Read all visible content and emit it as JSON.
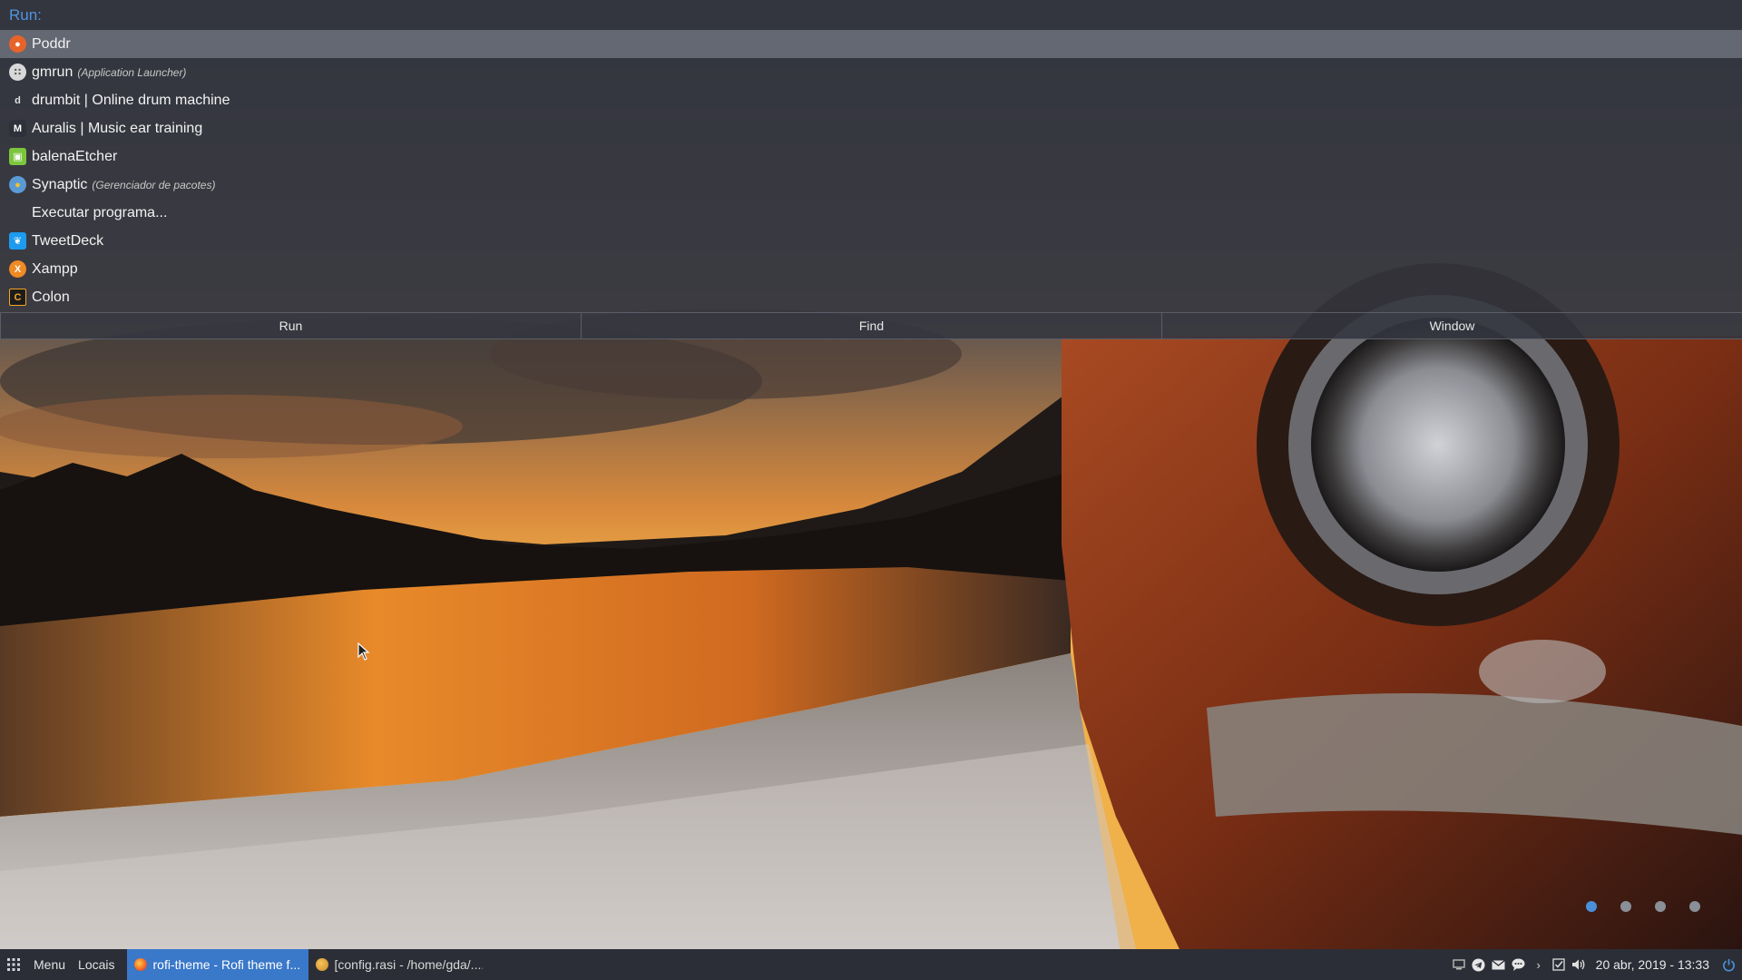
{
  "rofi": {
    "prompt": "Run:",
    "items": [
      {
        "name": "Poddr",
        "subtitle": "",
        "icon": "poddr-icon",
        "selected": true
      },
      {
        "name": "gmrun",
        "subtitle": "(Application Launcher)",
        "icon": "gmrun-icon",
        "selected": false
      },
      {
        "name": "drumbit | Online drum machine",
        "subtitle": "",
        "icon": "drumbit-icon",
        "selected": false
      },
      {
        "name": "Auralis | Music ear training",
        "subtitle": "",
        "icon": "auralis-icon",
        "selected": false
      },
      {
        "name": "balenaEtcher",
        "subtitle": "",
        "icon": "etcher-icon",
        "selected": false
      },
      {
        "name": "Synaptic",
        "subtitle": "(Gerenciador de pacotes)",
        "icon": "synaptic-icon",
        "selected": false
      },
      {
        "name": "Executar programa...",
        "subtitle": "",
        "icon": "",
        "selected": false
      },
      {
        "name": "TweetDeck",
        "subtitle": "",
        "icon": "tweetdeck-icon",
        "selected": false
      },
      {
        "name": "Xampp",
        "subtitle": "",
        "icon": "xampp-icon",
        "selected": false
      },
      {
        "name": "Colon",
        "subtitle": "",
        "icon": "colon-icon",
        "selected": false
      }
    ],
    "modes": [
      "Run",
      "Find",
      "Window"
    ]
  },
  "workspaces": {
    "count": 4,
    "active": 1
  },
  "taskbar": {
    "menu_label": "Menu",
    "places_label": "Locais",
    "tasks": [
      {
        "title": "rofi-theme - Rofi theme f...",
        "active": true
      },
      {
        "title": "[config.rasi - /home/gda/....",
        "active": false
      }
    ],
    "clock": "20 abr, 2019 - 13:33"
  },
  "colors": {
    "accent": "#5294e2",
    "selection": "#8c929e",
    "taskbar_bg": "#2b2e36",
    "active_task": "#3a78c9"
  }
}
